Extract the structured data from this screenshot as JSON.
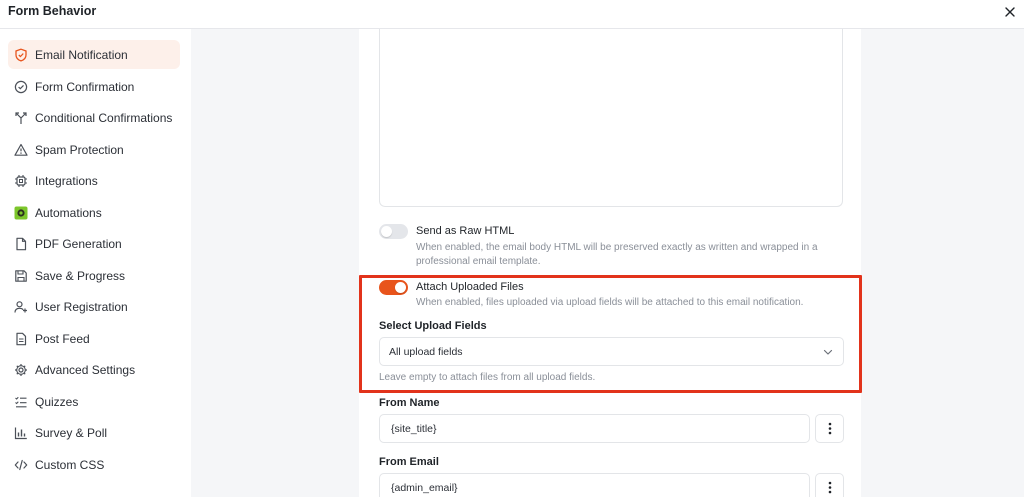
{
  "window": {
    "title": "Form Behavior"
  },
  "sidebar": {
    "items": [
      {
        "label": "Email Notification",
        "icon": "shield-icon",
        "active": true
      },
      {
        "label": "Form Confirmation",
        "icon": "check-circle-icon"
      },
      {
        "label": "Conditional Confirmations",
        "icon": "split-arrows-icon"
      },
      {
        "label": "Spam Protection",
        "icon": "warning-triangle-icon"
      },
      {
        "label": "Integrations",
        "icon": "chip-icon"
      },
      {
        "label": "Automations",
        "icon": "automations-logo-icon"
      },
      {
        "label": "PDF Generation",
        "icon": "document-icon"
      },
      {
        "label": "Save & Progress",
        "icon": "floppy-disk-icon"
      },
      {
        "label": "User Registration",
        "icon": "user-plus-icon"
      },
      {
        "label": "Post Feed",
        "icon": "file-text-icon"
      },
      {
        "label": "Advanced Settings",
        "icon": "gear-icon"
      },
      {
        "label": "Quizzes",
        "icon": "checklist-icon"
      },
      {
        "label": "Survey & Poll",
        "icon": "bar-chart-icon"
      },
      {
        "label": "Custom CSS",
        "icon": "code-icon"
      }
    ]
  },
  "settings": {
    "raw_html": {
      "label": "Send as Raw HTML",
      "help_line1": "When enabled, the email body HTML will be preserved exactly as written and wrapped in a",
      "help_line2": "professional email template.",
      "enabled": false
    },
    "attach_files": {
      "label": "Attach Uploaded Files",
      "help": "When enabled, files uploaded via upload fields will be attached to this email notification.",
      "enabled": true
    },
    "upload_fields": {
      "label": "Select Upload Fields",
      "value": "All upload fields",
      "help": "Leave empty to attach files from all upload fields."
    },
    "from_name": {
      "label": "From Name",
      "value": "{site_title}"
    },
    "from_email": {
      "label": "From Email",
      "value": "{admin_email}"
    }
  },
  "colors": {
    "accent": "#e8541c",
    "highlight": "#e2331b",
    "active_bg": "#fdf0ea"
  }
}
